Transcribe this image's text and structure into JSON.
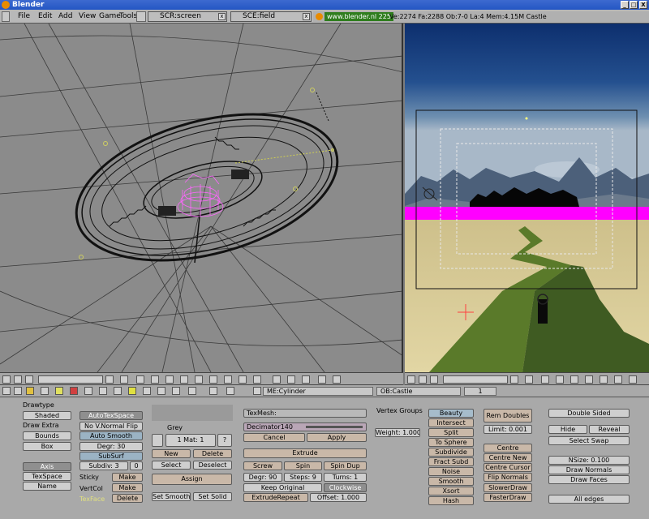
{
  "window": {
    "title": "Blender",
    "buttons": [
      "_",
      "□",
      "X"
    ]
  },
  "menu": [
    "File",
    "Edit",
    "Add",
    "View",
    "Game",
    "Tools"
  ],
  "screen": {
    "label": "SCR:screen",
    "close": "x"
  },
  "scene": {
    "label": "SCE:field",
    "close": "x"
  },
  "info": {
    "site": "www.blender.nl 225",
    "stats": "Ve:2274 Fa:2288  Ob:7-0 La:4  Mem:4.15M   Castle"
  },
  "header": {
    "mesh": "ME:Cylinder",
    "object": "OB:Castle",
    "users": "1"
  },
  "panel": {
    "drawtype_label": "Drawtype",
    "drawtype_value": "Shaded",
    "drawextra_label": "Draw Extra",
    "bounds": "Bounds",
    "box": "Box",
    "axis": "Axis",
    "texspace": "TexSpace",
    "name": "Name",
    "autotexspace": "AutoTexSpace",
    "nonormalflip": "No V.Normal Flip",
    "autosmooth": "Auto Smooth",
    "degr": "Degr: 30",
    "subsurf": "SubSurf",
    "subdiv": "Subdiv: 3",
    "subdiv2": "0",
    "sticky": "Sticky",
    "vertcol": "VertCol",
    "texface": "TexFace",
    "make": "Make",
    "delete": "Delete",
    "grey": "Grey",
    "mat": "1 Mat: 1",
    "q": "?",
    "new": "New",
    "select": "Select",
    "deselect": "Deselect",
    "assign": "Assign",
    "setsmooth": "Set Smooth",
    "setsolid": "Set Solid",
    "texmesh": "TexMesh:",
    "decimator": "Decimator140",
    "cancel": "Cancel",
    "apply": "Apply",
    "extrude": "Extrude",
    "screw": "Screw",
    "spin": "Spin",
    "spindup": "Spin Dup",
    "degr90": "Degr: 90",
    "steps": "Steps: 9",
    "turns": "Turns: 1",
    "keeporiginal": "Keep Original",
    "clockwise": "Clockwise",
    "extruderepeat": "ExtrudeRepeat",
    "offset": "Offset: 1.000",
    "vertexgroups": "Vertex Groups",
    "weight": "Weight: 1.000",
    "beauty": "Beauty",
    "intersect": "Intersect",
    "split": "Split",
    "tosphere": "To Sphere",
    "subdivide": "Subdivide",
    "fractsubd": "Fract Subd",
    "noise": "Noise",
    "smooth": "Smooth",
    "xsort": "Xsort",
    "hash": "Hash",
    "remdoubles": "Rem Doubles",
    "limit": "Limit: 0.001",
    "centre": "Centre",
    "centrenew": "Centre New",
    "centrecursor": "Centre Cursor",
    "flipnormals": "Flip Normals",
    "slowerdraw": "SlowerDraw",
    "fasterdraw": "FasterDraw",
    "doublesided": "Double Sided",
    "hide": "Hide",
    "reveal": "Reveal",
    "selectswap": "Select Swap",
    "nsize": "NSize: 0.100",
    "drawnormals": "Draw Normals",
    "drawfaces": "Draw Faces",
    "alledges": "All edges"
  },
  "colors": {
    "sky_top": "#0d2f6e",
    "sky_bottom": "#6e8fb0",
    "ground": "#d8c892",
    "path": "#5a7a2a",
    "magenta": "#ff00ff",
    "titlebar": "#2456c4"
  }
}
